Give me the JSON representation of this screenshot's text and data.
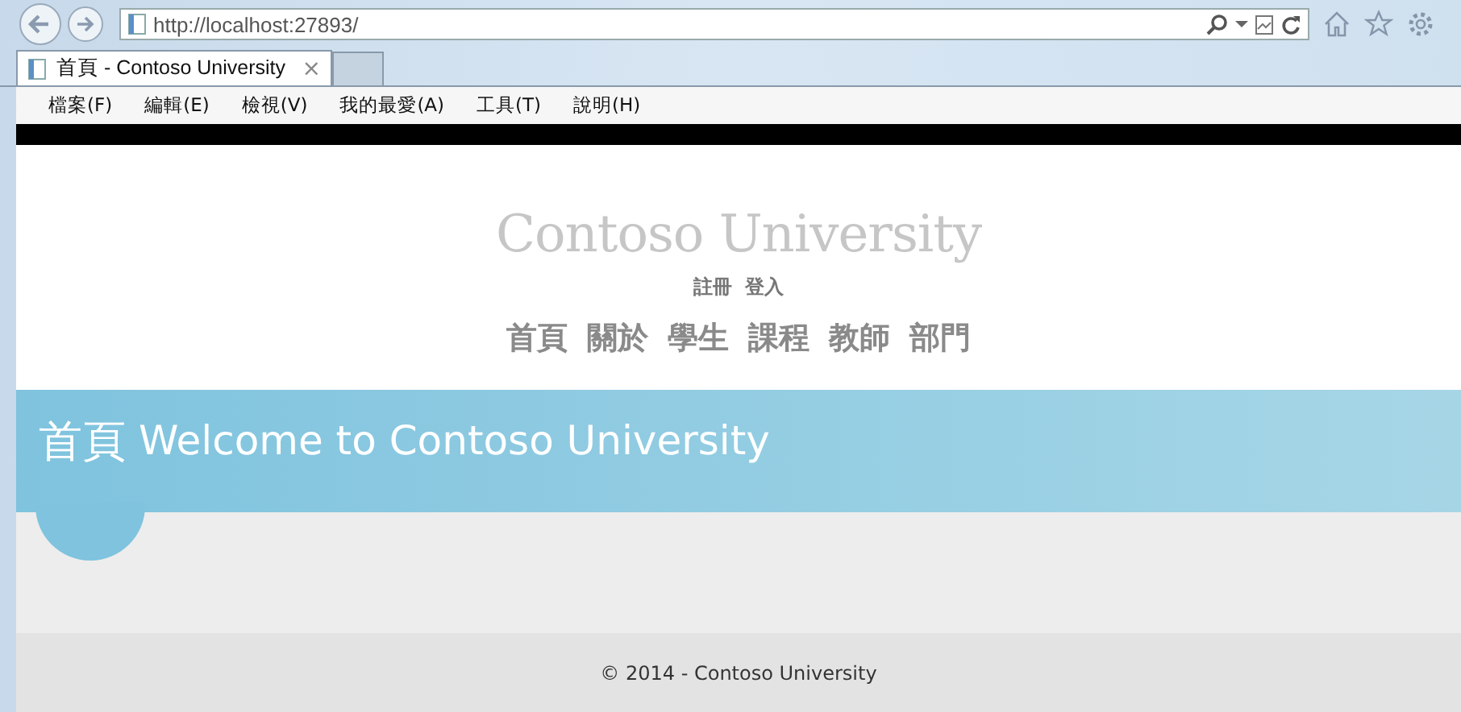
{
  "browser": {
    "address": "http://localhost:27893/",
    "tabs": [
      {
        "title": "首頁 - Contoso University",
        "close": "×",
        "selected": true
      }
    ],
    "menu": [
      "檔案(F)",
      "編輯(E)",
      "檢視(V)",
      "我的最愛(A)",
      "工具(T)",
      "說明(H)"
    ]
  },
  "site": {
    "brand": "Contoso University",
    "account_links": [
      "註冊",
      "登入"
    ],
    "nav": [
      "首頁",
      "關於",
      "學生",
      "課程",
      "教師",
      "部門"
    ]
  },
  "banner": {
    "title": "首頁",
    "message": "Welcome to Contoso University"
  },
  "footer": "© 2014 - Contoso University"
}
